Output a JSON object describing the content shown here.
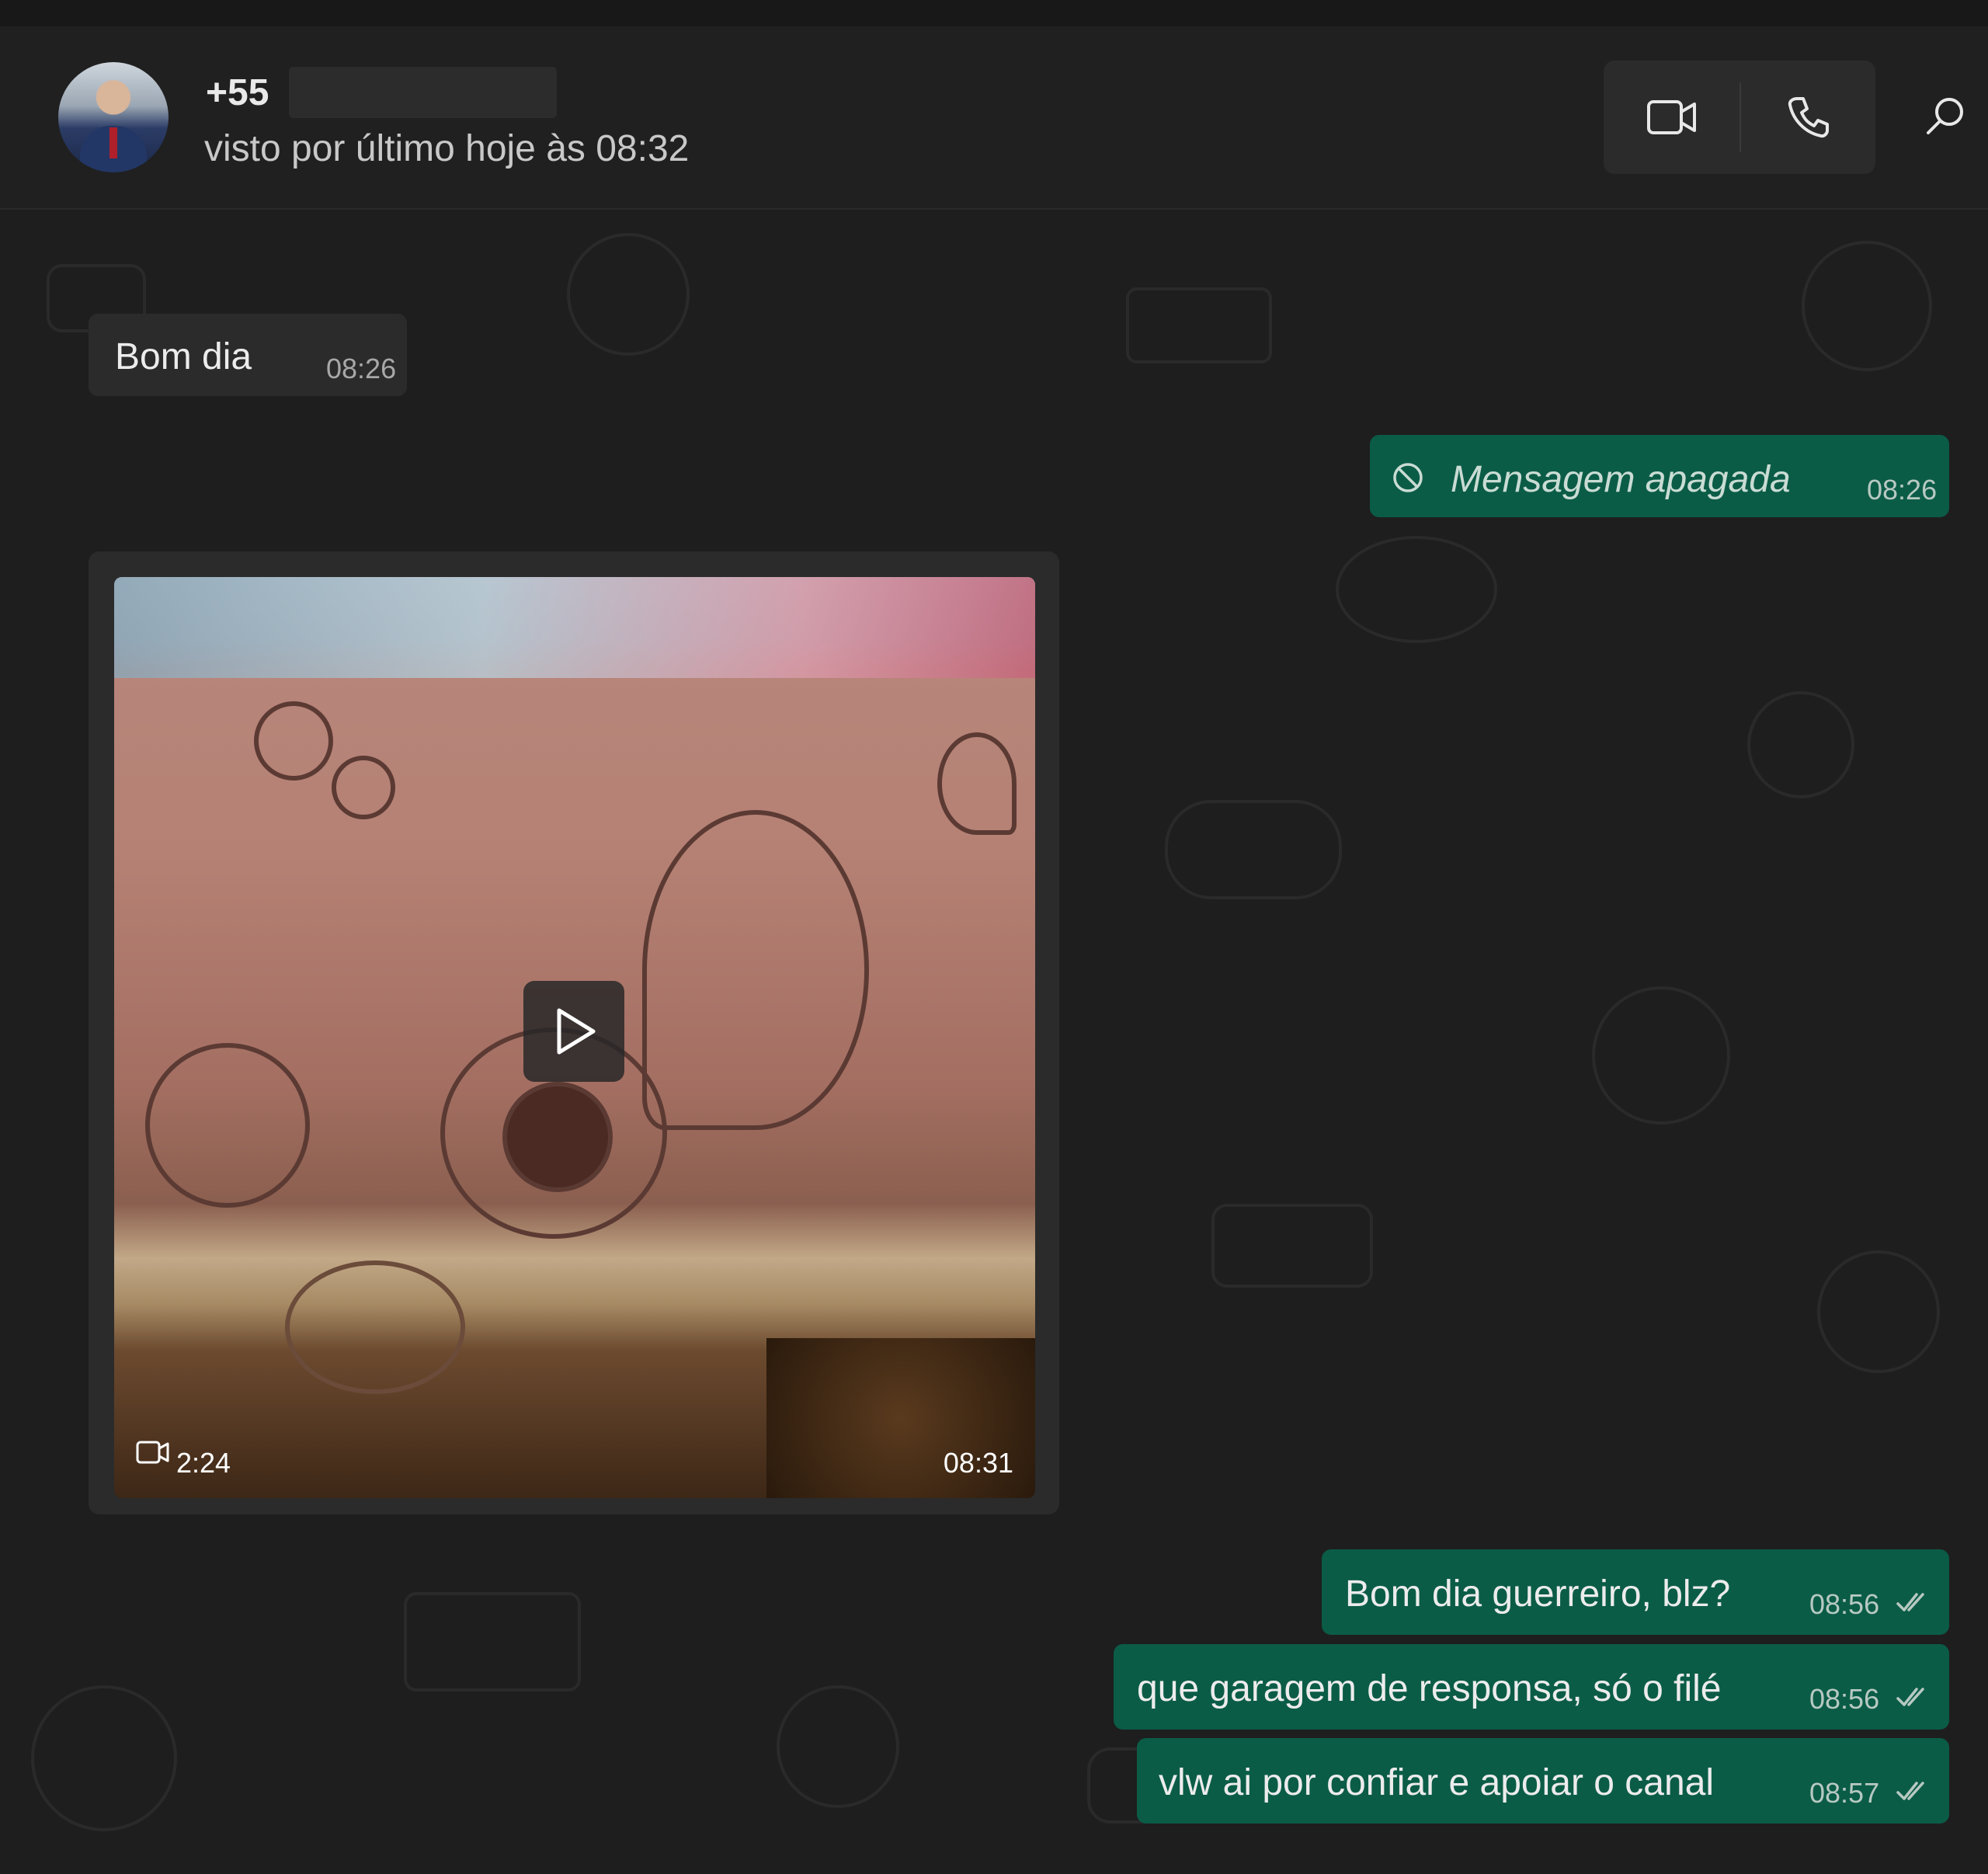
{
  "header": {
    "contact_name": "+55",
    "status": "visto por último hoje às 08:32"
  },
  "messages": [
    {
      "direction": "in",
      "text": "Bom dia",
      "time": "08:26"
    },
    {
      "direction": "out",
      "text": "Mensagem apagada",
      "time": "08:26",
      "deleted": true
    },
    {
      "direction": "in",
      "type": "video",
      "duration": "2:24",
      "time": "08:31"
    },
    {
      "direction": "out",
      "text": "Bom dia guerreiro, blz?",
      "time": "08:56"
    },
    {
      "direction": "out",
      "text": "que garagem de responsa, só o filé",
      "time": "08:56"
    },
    {
      "direction": "out",
      "text": "vlw ai por confiar e apoiar o canal",
      "time": "08:57"
    }
  ],
  "icons": {
    "video_call": "video-camera-icon",
    "voice_call": "phone-icon",
    "search": "search-icon",
    "deleted": "blocked-icon",
    "play": "play-icon",
    "read_receipt": "double-check-icon"
  },
  "colors": {
    "outgoing_bubble": "#0b5c47",
    "incoming_bubble": "#2b2b2b",
    "background": "#1e1e1e"
  }
}
